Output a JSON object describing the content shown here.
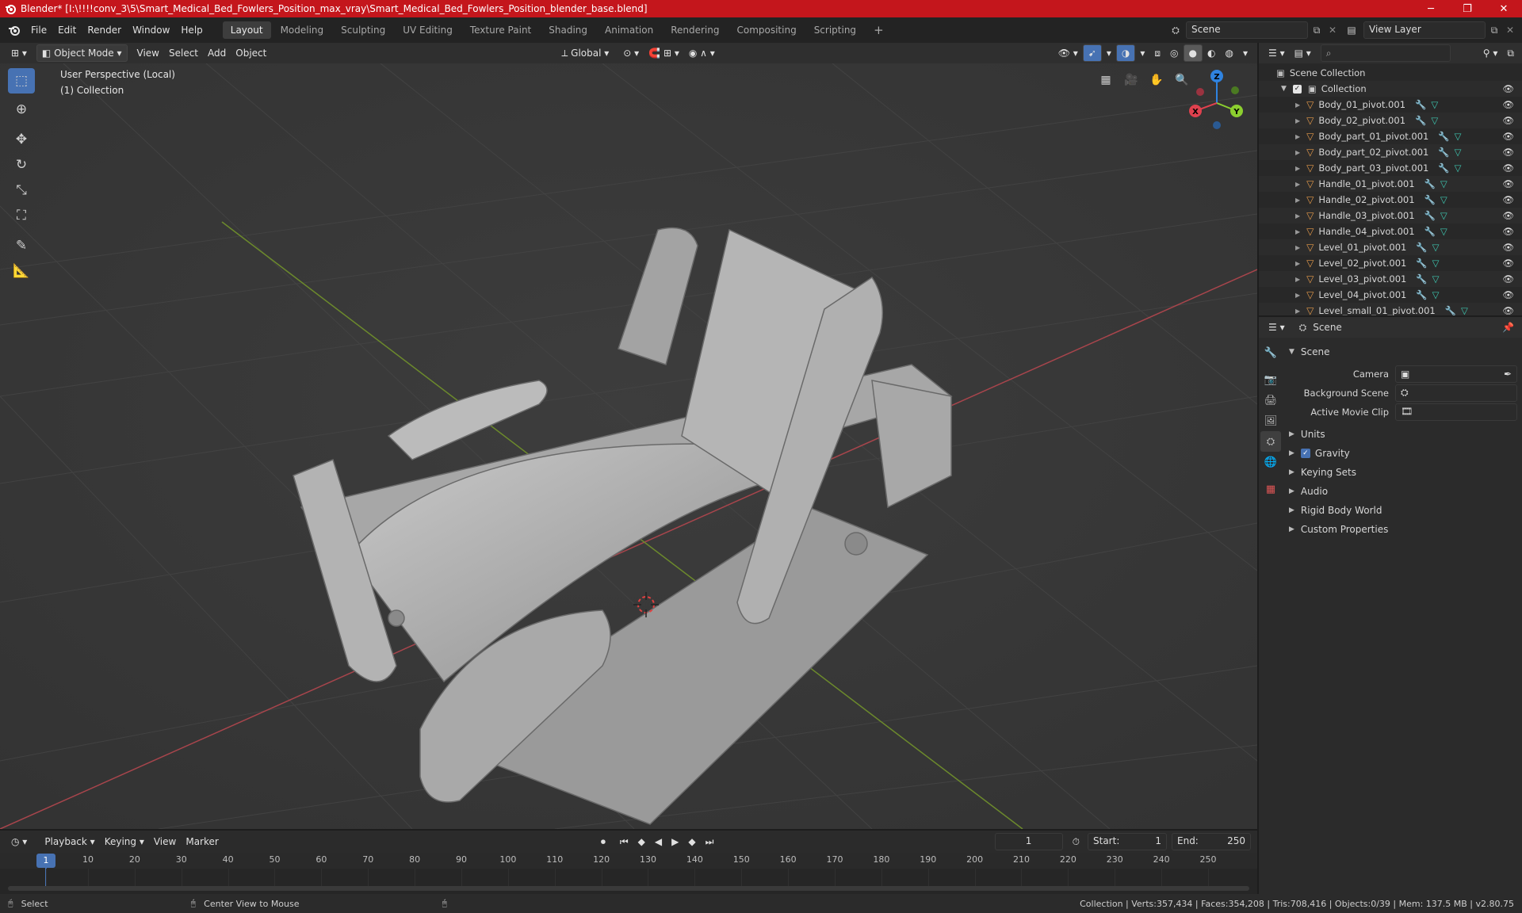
{
  "window": {
    "title": "Blender* [I:\\!!!!conv_3\\5\\Smart_Medical_Bed_Fowlers_Position_max_vray\\Smart_Medical_Bed_Fowlers_Position_blender_base.blend]",
    "minimize": "─",
    "maximize": "❐",
    "close": "✕"
  },
  "menus": [
    "File",
    "Edit",
    "Render",
    "Window",
    "Help"
  ],
  "workspaces": [
    "Layout",
    "Modeling",
    "Sculpting",
    "UV Editing",
    "Texture Paint",
    "Shading",
    "Animation",
    "Rendering",
    "Compositing",
    "Scripting"
  ],
  "active_workspace": "Layout",
  "add_workspace": "+",
  "scene_field": "Scene",
  "view_layer_field": "View Layer",
  "viewport_header": {
    "mode": "Object Mode",
    "menus": [
      "View",
      "Select",
      "Add",
      "Object"
    ],
    "orientation": "Global"
  },
  "viewport": {
    "perspective": "User Perspective (Local)",
    "collection": "(1) Collection",
    "gizmo": {
      "x": "X",
      "y": "Y",
      "z": "Z"
    }
  },
  "outliner": {
    "search_placeholder": "",
    "scene_collection": "Scene Collection",
    "collection": "Collection",
    "items": [
      "Body_01_pivot.001",
      "Body_02_pivot.001",
      "Body_part_01_pivot.001",
      "Body_part_02_pivot.001",
      "Body_part_03_pivot.001",
      "Handle_01_pivot.001",
      "Handle_02_pivot.001",
      "Handle_03_pivot.001",
      "Handle_04_pivot.001",
      "Level_01_pivot.001",
      "Level_02_pivot.001",
      "Level_03_pivot.001",
      "Level_04_pivot.001",
      "Level_small_01_pivot.001"
    ]
  },
  "properties": {
    "context": "Scene",
    "panel": "Scene",
    "camera_label": "Camera",
    "background_scene_label": "Background Scene",
    "active_movie_clip_label": "Active Movie Clip",
    "sections": [
      "Units",
      "Gravity",
      "Keying Sets",
      "Audio",
      "Rigid Body World",
      "Custom Properties"
    ],
    "gravity_checked": true
  },
  "timeline": {
    "menus": [
      "Playback",
      "Keying",
      "View",
      "Marker"
    ],
    "current_frame": "1",
    "start_label": "Start:",
    "start": "1",
    "end_label": "End:",
    "end": "250",
    "ticks": [
      "1",
      "10",
      "20",
      "30",
      "40",
      "50",
      "60",
      "70",
      "80",
      "90",
      "100",
      "110",
      "120",
      "130",
      "140",
      "150",
      "160",
      "170",
      "180",
      "190",
      "200",
      "210",
      "220",
      "230",
      "240",
      "250"
    ]
  },
  "status": {
    "left": "Select",
    "middle": "Center View to Mouse",
    "right": "Collection | Verts:357,434 | Faces:354,208 | Tris:708,416 | Objects:0/39 | Mem: 137.5 MB | v2.80.75"
  },
  "colors": {
    "title_bar": "#c4161c",
    "active_tool": "#4772b3",
    "x_axis": "#e0414e",
    "y_axis": "#8ccf2f",
    "z_axis": "#2f83e0",
    "mesh_icon": "#e59a4a",
    "modifier_icon": "#6aa6e8",
    "data_icon": "#3ec6b0"
  }
}
